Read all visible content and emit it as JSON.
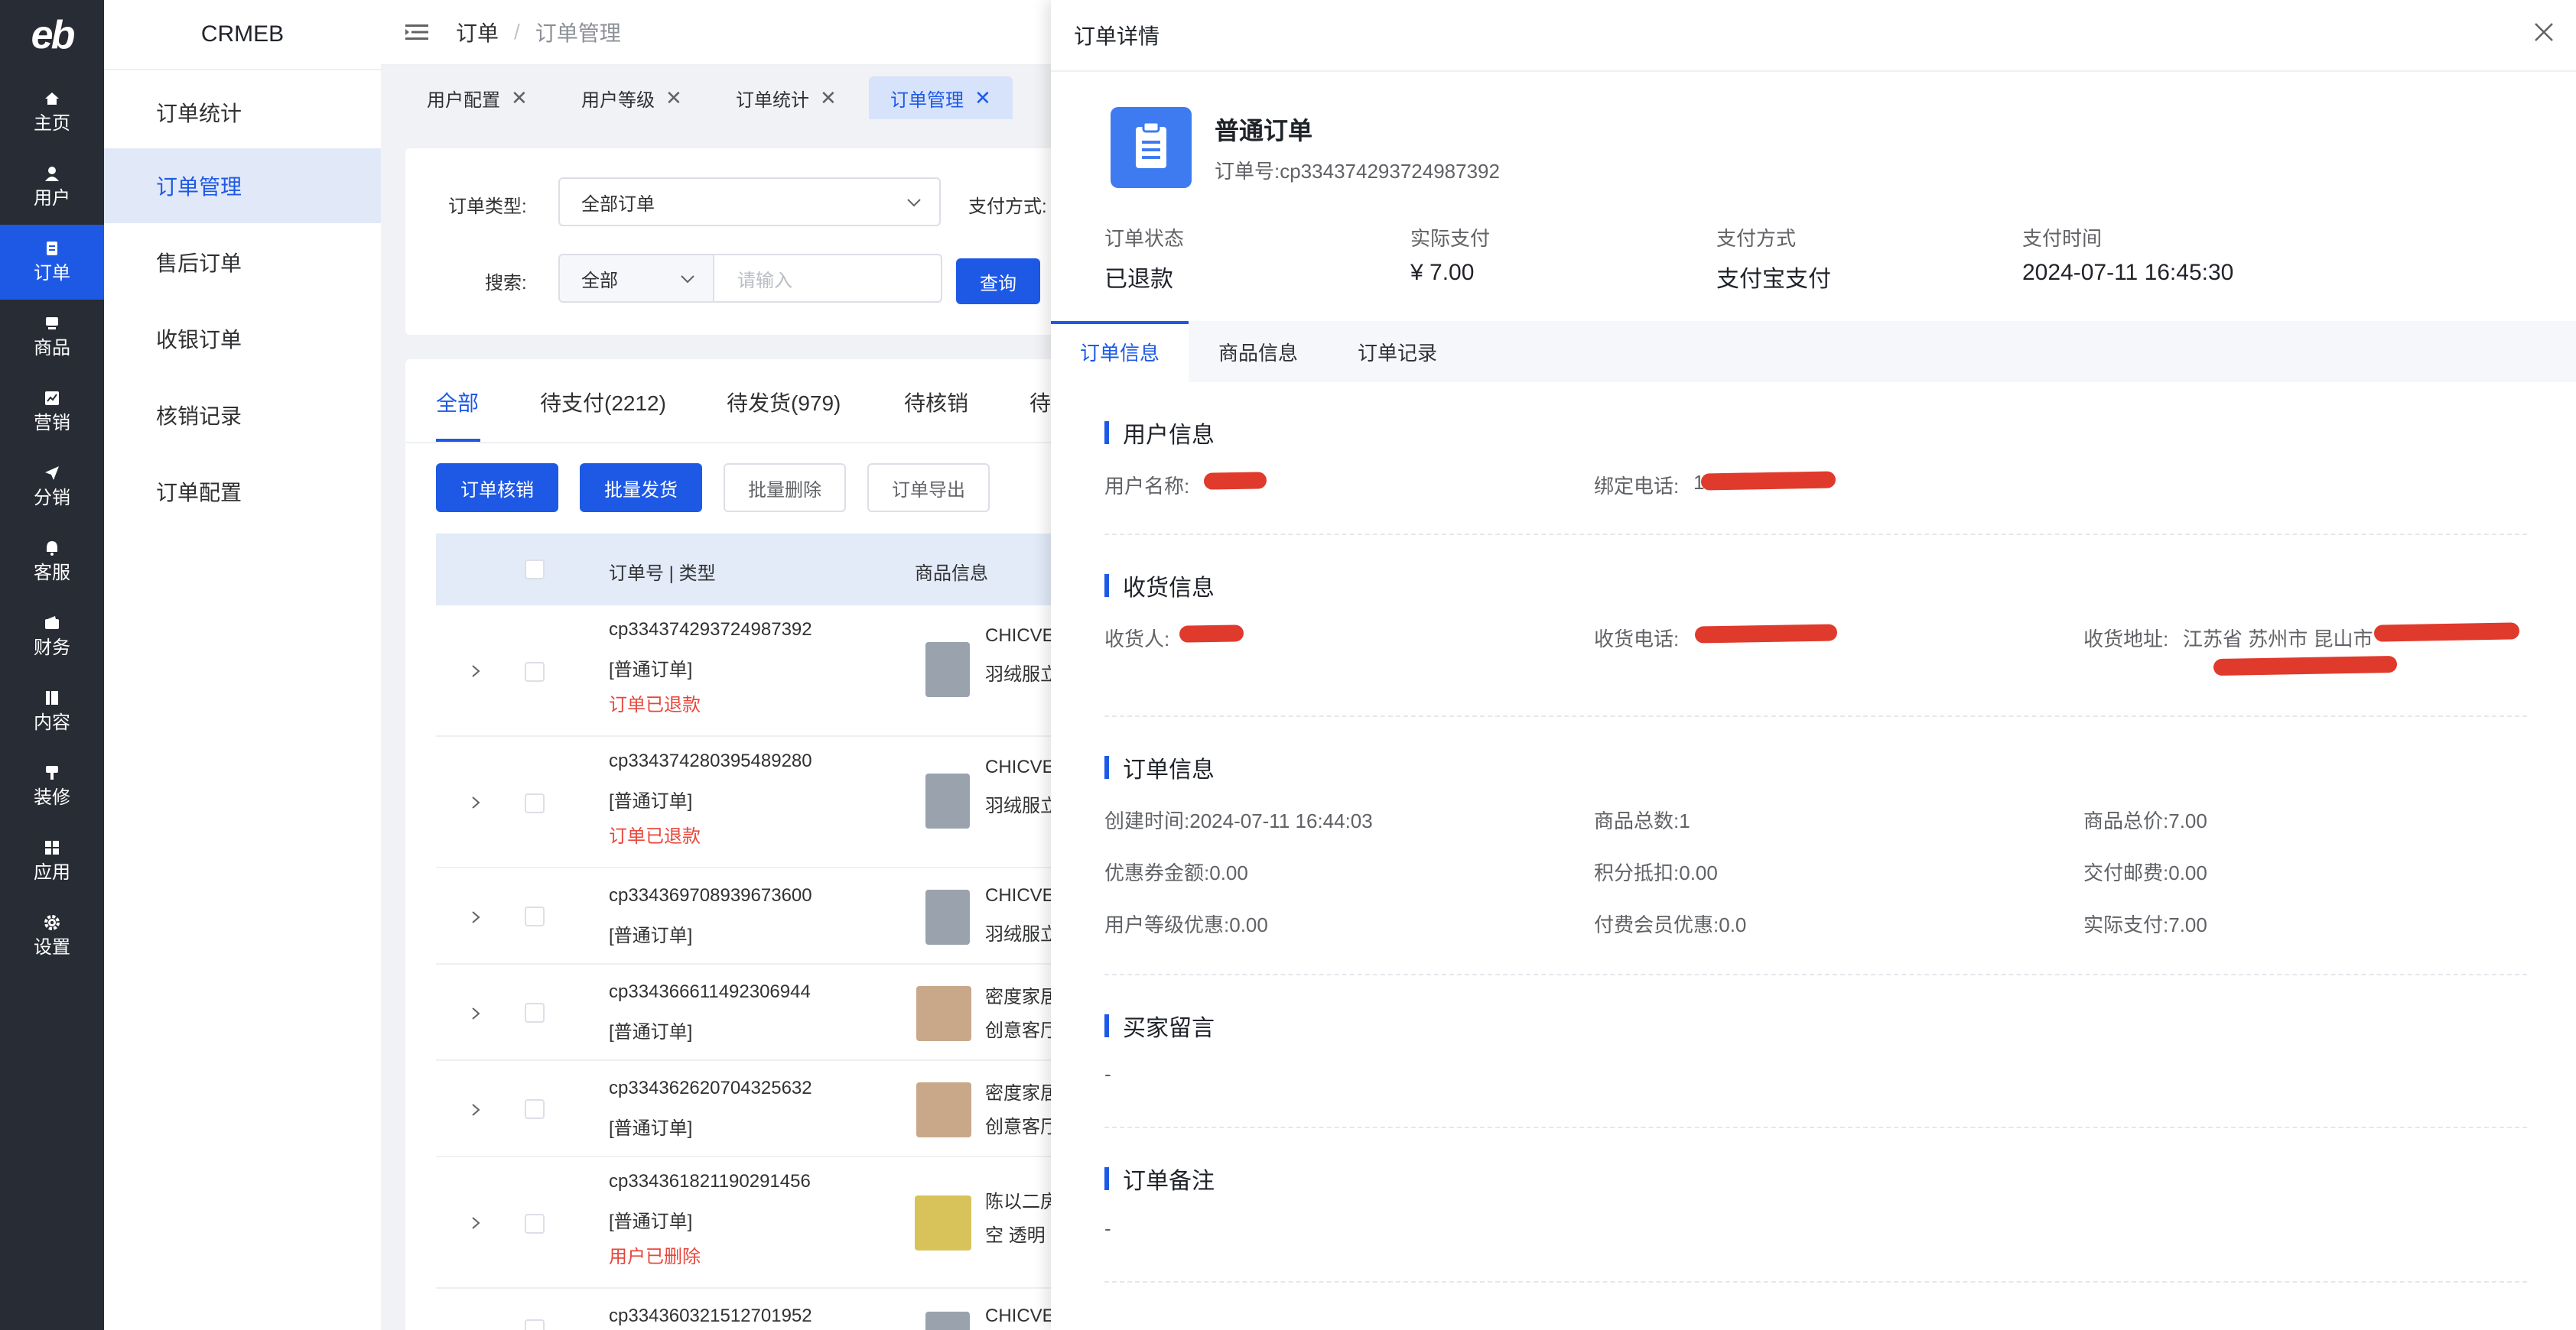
{
  "rail": {
    "items": [
      {
        "label": "主页",
        "icon": "home-icon"
      },
      {
        "label": "用户",
        "icon": "user-icon"
      },
      {
        "label": "订单",
        "icon": "order-icon",
        "active": true
      },
      {
        "label": "商品",
        "icon": "product-icon"
      },
      {
        "label": "营销",
        "icon": "marketing-icon"
      },
      {
        "label": "分销",
        "icon": "send-icon"
      },
      {
        "label": "客服",
        "icon": "bell-icon"
      },
      {
        "label": "财务",
        "icon": "wallet-icon"
      },
      {
        "label": "内容",
        "icon": "book-icon"
      },
      {
        "label": "装修",
        "icon": "brush-icon"
      },
      {
        "label": "应用",
        "icon": "apps-icon"
      },
      {
        "label": "设置",
        "icon": "gear-icon"
      }
    ]
  },
  "submenu": {
    "brand": "CRMEB",
    "items": [
      {
        "label": "订单统计"
      },
      {
        "label": "订单管理",
        "active": true
      },
      {
        "label": "售后订单"
      },
      {
        "label": "收银订单"
      },
      {
        "label": "核销记录"
      },
      {
        "label": "订单配置"
      }
    ]
  },
  "header": {
    "crumb_parent": "订单",
    "crumb_sep": "/",
    "crumb_current": "订单管理"
  },
  "tags": [
    {
      "label": "用户配置",
      "close": "✕"
    },
    {
      "label": "用户等级",
      "close": "✕"
    },
    {
      "label": "订单统计",
      "close": "✕"
    },
    {
      "label": "订单管理",
      "close": "✕",
      "active": true
    }
  ],
  "filters": {
    "type_label": "订单类型:",
    "type_value": "全部订单",
    "pay_label": "支付方式:",
    "search_label": "搜索:",
    "search_scope": "全部",
    "search_placeholder": "请输入",
    "query_button": "查询"
  },
  "status_tabs": [
    {
      "label": "全部",
      "active": true
    },
    {
      "label": "待支付(2212)"
    },
    {
      "label": "待发货(979)"
    },
    {
      "label": "待核销"
    },
    {
      "label": "待"
    }
  ],
  "actions": {
    "verify": "订单核销",
    "batch_ship": "批量发货",
    "batch_delete": "批量删除",
    "export": "订单导出"
  },
  "table": {
    "col_order": "订单号 | 类型",
    "col_product": "商品信息",
    "rows": [
      {
        "order_no": "cp334374293724987392",
        "type": "[普通订单]",
        "status": "订单已退款",
        "prod1": "CHICVE",
        "prod2": "羽绒服立",
        "thumb": "#9aa3ad"
      },
      {
        "order_no": "cp334374280395489280",
        "type": "[普通订单]",
        "status": "订单已退款",
        "prod1": "CHICVE",
        "prod2": "羽绒服立",
        "thumb": "#9aa3ad"
      },
      {
        "order_no": "cp334369708939673600",
        "type": "[普通订单]",
        "status": "",
        "prod1": "CHICVE",
        "prod2": "羽绒服立",
        "thumb": "#9aa3ad"
      },
      {
        "order_no": "cp334366611492306944",
        "type": "[普通订单]",
        "status": "",
        "prod1": "密度家居",
        "prod2": "创意客厅",
        "thumb": "#c9a88a"
      },
      {
        "order_no": "cp334362620704325632",
        "type": "[普通订单]",
        "status": "",
        "prod1": "密度家居",
        "prod2": "创意客厅",
        "thumb": "#c9a88a"
      },
      {
        "order_no": "cp334361821190291456",
        "type": "[普通订单]",
        "status": "用户已删除",
        "prod1": "陈以二房",
        "prod2": "空 透明",
        "thumb": "#d8c25a"
      },
      {
        "order_no": "cp334360321512701952",
        "type": "",
        "status": "",
        "prod1": "CHICVE",
        "prod2": "",
        "thumb": "#9aa3ad"
      }
    ]
  },
  "drawer": {
    "title": "订单详情",
    "order_type": "普通订单",
    "order_no": "订单号:cp334374293724987392",
    "summary": [
      {
        "label": "订单状态",
        "value": "已退款"
      },
      {
        "label": "实际支付",
        "value": "¥ 7.00"
      },
      {
        "label": "支付方式",
        "value": "支付宝支付"
      },
      {
        "label": "支付时间",
        "value": "2024-07-11 16:45:30"
      }
    ],
    "tabs": [
      {
        "label": "订单信息",
        "active": true
      },
      {
        "label": "商品信息"
      },
      {
        "label": "订单记录"
      }
    ],
    "user_info": {
      "title": "用户信息",
      "name_label": "用户名称:",
      "phone_label": "绑定电话:",
      "phone_visible": "1"
    },
    "shipping_info": {
      "title": "收货信息",
      "receiver_label": "收货人:",
      "phone_label": "收货电话:",
      "address_label": "收货地址:",
      "address_value": "江苏省 苏州市 昆山市"
    },
    "order_info": {
      "title": "订单信息",
      "fields": [
        {
          "label": "创建时间:",
          "value": "2024-07-11 16:44:03"
        },
        {
          "label": "商品总数:",
          "value": "1"
        },
        {
          "label": "商品总价:",
          "value": "7.00"
        },
        {
          "label": "优惠券金额:",
          "value": "0.00"
        },
        {
          "label": "积分抵扣:",
          "value": "0.00"
        },
        {
          "label": "交付邮费:",
          "value": "0.00"
        },
        {
          "label": "用户等级优惠:",
          "value": "0.00"
        },
        {
          "label": "付费会员优惠:",
          "value": "0.0"
        },
        {
          "label": "实际支付:",
          "value": "7.00"
        }
      ]
    },
    "buyer_note": {
      "title": "买家留言",
      "value": "-"
    },
    "order_note": {
      "title": "订单备注",
      "value": "-"
    }
  },
  "colors": {
    "primary": "#1e59e6",
    "rail_bg": "#282c34",
    "danger": "#e8463a",
    "redaction": "#e03a2c"
  }
}
